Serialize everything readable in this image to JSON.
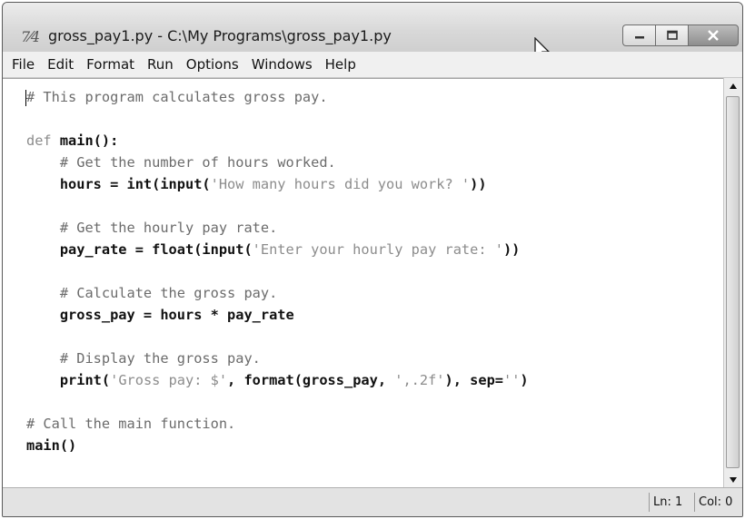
{
  "window": {
    "title": "gross_pay1.py - C:\\My Programs\\gross_pay1.py",
    "app_icon_text": "7⁄4"
  },
  "menu": [
    "File",
    "Edit",
    "Format",
    "Run",
    "Options",
    "Windows",
    "Help"
  ],
  "code": {
    "line1": "# This program calculates gross pay.",
    "line3_kw": "def",
    "line3_rest": " main():",
    "line4": "    # Get the number of hours worked.",
    "line5_a": "    hours = int(input(",
    "line5_str": "'How many hours did you work? '",
    "line5_b": "))",
    "line7": "    # Get the hourly pay rate.",
    "line8_a": "    pay_rate = float(input(",
    "line8_str": "'Enter your hourly pay rate: '",
    "line8_b": "))",
    "line10": "    # Calculate the gross pay.",
    "line11": "    gross_pay = hours * pay_rate",
    "line13": "    # Display the gross pay.",
    "line14_a": "    print(",
    "line14_str1": "'Gross pay: $'",
    "line14_b": ", format(gross_pay, ",
    "line14_str2": "',.2f'",
    "line14_c": "), sep=",
    "line14_str3": "''",
    "line14_d": ")",
    "line16": "# Call the main function.",
    "line17": "main()"
  },
  "status": {
    "ln": "Ln: 1",
    "col": "Col: 0"
  }
}
